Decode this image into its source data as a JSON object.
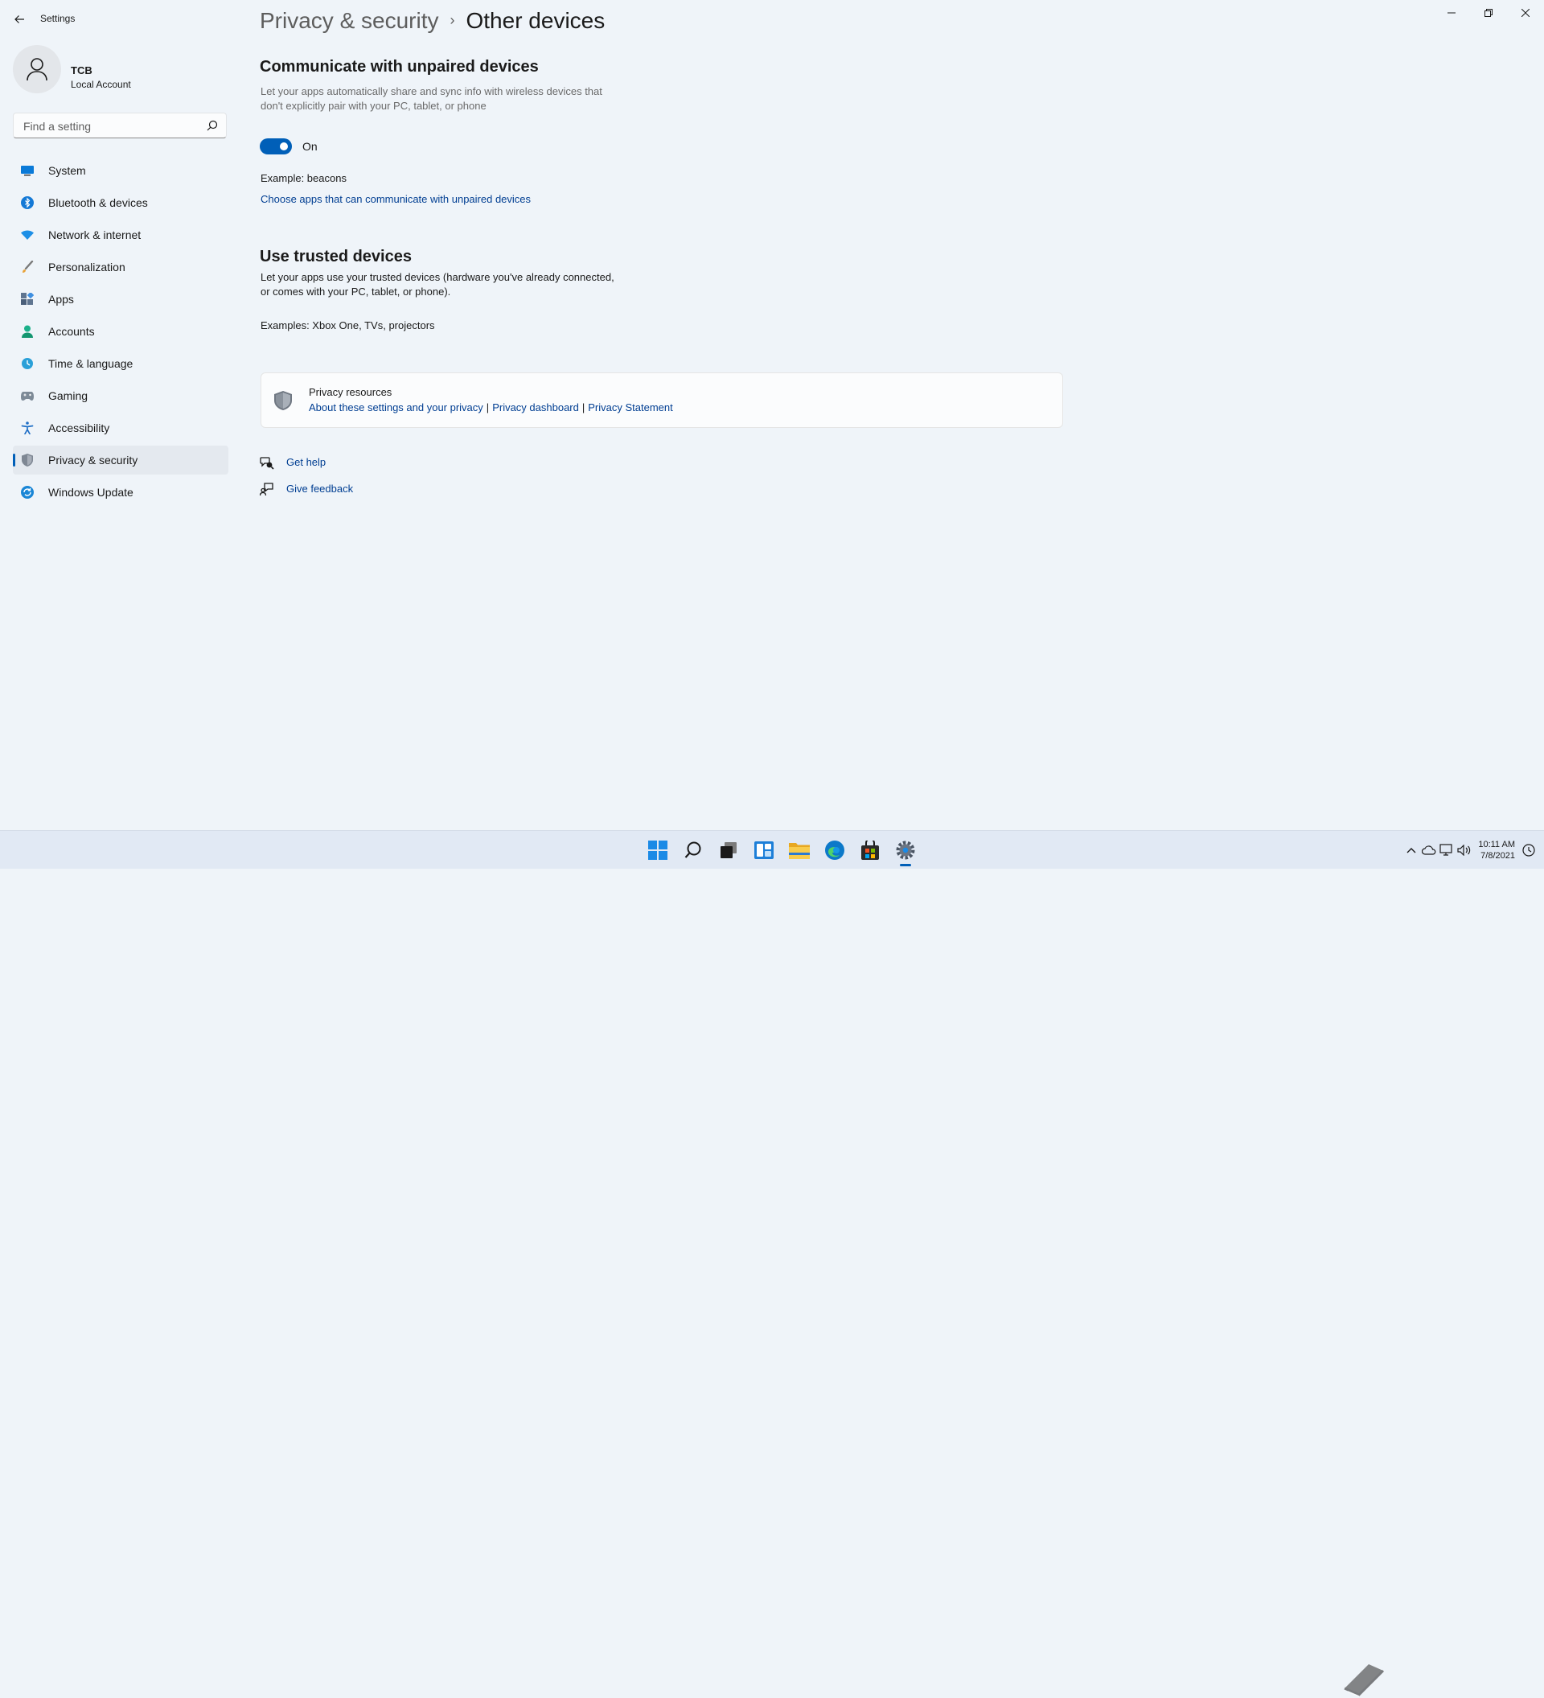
{
  "app": {
    "title": "Settings"
  },
  "profile": {
    "name": "TCB",
    "account_type": "Local Account"
  },
  "search": {
    "placeholder": "Find a setting"
  },
  "sidebar": {
    "items": [
      {
        "label": "System",
        "icon": "monitor-icon"
      },
      {
        "label": "Bluetooth & devices",
        "icon": "bluetooth-icon"
      },
      {
        "label": "Network & internet",
        "icon": "wifi-icon"
      },
      {
        "label": "Personalization",
        "icon": "brush-icon"
      },
      {
        "label": "Apps",
        "icon": "apps-icon"
      },
      {
        "label": "Accounts",
        "icon": "person-icon"
      },
      {
        "label": "Time & language",
        "icon": "globe-clock-icon"
      },
      {
        "label": "Gaming",
        "icon": "gamepad-icon"
      },
      {
        "label": "Accessibility",
        "icon": "accessibility-icon"
      },
      {
        "label": "Privacy & security",
        "icon": "shield-icon",
        "selected": true
      },
      {
        "label": "Windows Update",
        "icon": "update-icon"
      }
    ]
  },
  "breadcrumb": {
    "parent": "Privacy & security",
    "separator": "›",
    "current": "Other devices"
  },
  "unpaired": {
    "title": "Communicate with unpaired devices",
    "description": "Let your apps automatically share and sync info with wireless devices that don't explicitly pair with your PC, tablet, or phone",
    "toggle_state": "On",
    "example": "Example: beacons",
    "link": "Choose apps that can communicate with unpaired devices"
  },
  "trusted": {
    "title": "Use trusted devices",
    "description": "Let your apps use your trusted devices (hardware you've already connected, or comes with your PC, tablet, or phone).",
    "example": "Examples: Xbox One, TVs, projectors"
  },
  "privacy_resources": {
    "title": "Privacy resources",
    "links": [
      "About these settings and your privacy",
      "Privacy dashboard",
      "Privacy Statement"
    ],
    "separator": "|"
  },
  "help": {
    "get_help": "Get help",
    "give_feedback": "Give feedback"
  },
  "taskbar": {
    "apps": [
      "start-icon",
      "search-icon",
      "task-view-icon",
      "widgets-icon",
      "file-explorer-icon",
      "edge-icon",
      "store-icon",
      "settings-icon"
    ],
    "clock_time": "10:11 AM",
    "clock_date": "7/8/2021"
  },
  "colors": {
    "accent": "#005fb8",
    "link": "#003e92",
    "background": "#eff4f9"
  }
}
